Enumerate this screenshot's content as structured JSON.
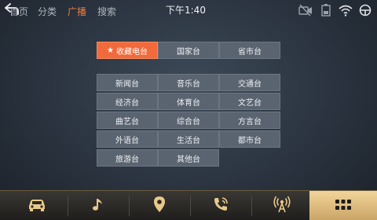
{
  "header": {
    "tabs": [
      {
        "label": "首页"
      },
      {
        "label": "分类"
      },
      {
        "label": "广播"
      },
      {
        "label": "搜索"
      }
    ],
    "time": "下午1:40"
  },
  "categories": {
    "top_row": [
      "收藏电台",
      "国家台",
      "省市台"
    ],
    "grid": [
      "新闻台",
      "音乐台",
      "交通台",
      "经济台",
      "体育台",
      "文艺台",
      "曲艺台",
      "综合台",
      "方言台",
      "外语台",
      "生活台",
      "都市台",
      "旅游台",
      "其他台"
    ]
  },
  "colors": {
    "accent": "#f06a3c",
    "active_tab": "#f07a3a",
    "dock_active": "#e6c27f"
  },
  "dock": {
    "items": [
      "car-icon",
      "music-icon",
      "location-icon",
      "phone-icon",
      "radio-icon",
      "apps-grid-icon"
    ],
    "active_index": 5
  }
}
